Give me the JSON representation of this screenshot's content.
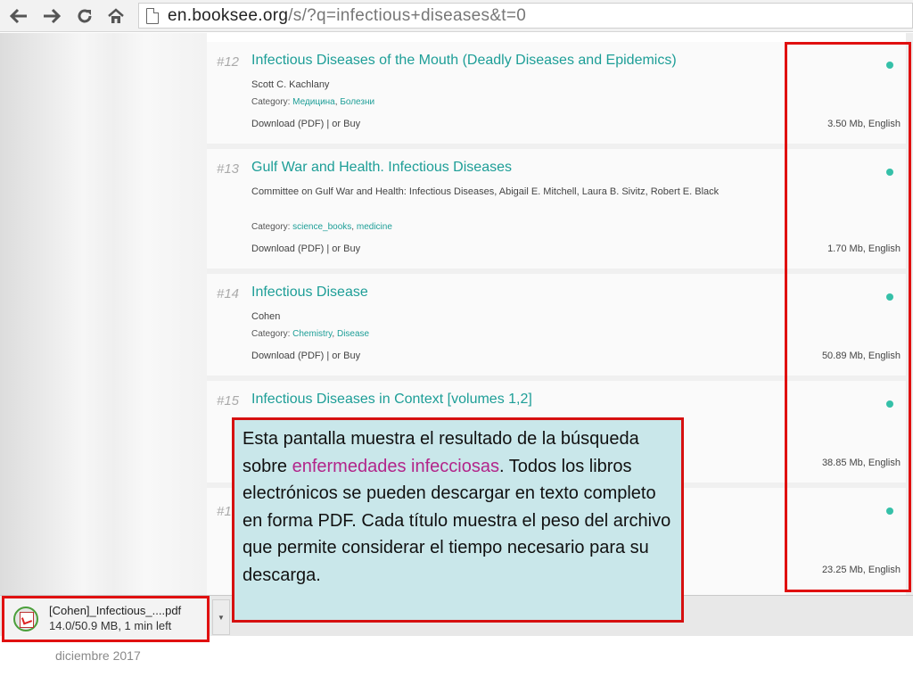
{
  "browser": {
    "url_host": "en.booksee.org",
    "url_path": "/s/?q=infectious+diseases&t=0"
  },
  "results": [
    {
      "num": "#12",
      "title": "Infectious Diseases of the Mouth (Deadly Diseases and Epidemics)",
      "author": "Scott C. Kachlany",
      "category_label": "Category:",
      "categories": [
        "Медицина",
        "Болезни"
      ],
      "download": "Download (PDF) | or Buy",
      "size": "3.50 Mb, English"
    },
    {
      "num": "#13",
      "title": "Gulf War and Health. Infectious Diseases",
      "author": "Committee on Gulf War and Health: Infectious Diseases, Abigail E. Mitchell, Laura B. Sivitz, Robert E. Black",
      "category_label": "Category:",
      "categories": [
        "science_books",
        "medicine"
      ],
      "download": "Download (PDF) | or Buy",
      "size": "1.70 Mb, English"
    },
    {
      "num": "#14",
      "title": "Infectious Disease",
      "author": "Cohen",
      "category_label": "Category:",
      "categories": [
        "Chemistry",
        "Disease"
      ],
      "download": "Download (PDF) | or Buy",
      "size": "50.89 Mb, English"
    },
    {
      "num": "#15",
      "title": "Infectious Diseases in Context [volumes 1,2]",
      "size": "38.85 Mb, English"
    },
    {
      "num": "#1",
      "size": "23.25 Mb, English"
    }
  ],
  "callout": {
    "text_before": "Esta pantalla muestra el resultado de la búsqueda sobre ",
    "highlight": "enfermedades infecciosas",
    "text_after": ". Todos los libros electrónicos se pueden descargar en texto completo en forma PDF. Cada título muestra el peso del archivo que permite considerar el tiempo necesario para su descarga."
  },
  "download_item": {
    "filename": "[Cohen]_Infectious_....pdf",
    "status": "14.0/50.9 MB, 1 min left"
  },
  "footer": {
    "date": "diciembre 2017"
  },
  "colors": {
    "link": "#1d9e97",
    "dot": "#35c0a8",
    "frame": "#e01010",
    "callout_bg": "#c9e7ea",
    "callout_highlight": "#b2258a"
  }
}
